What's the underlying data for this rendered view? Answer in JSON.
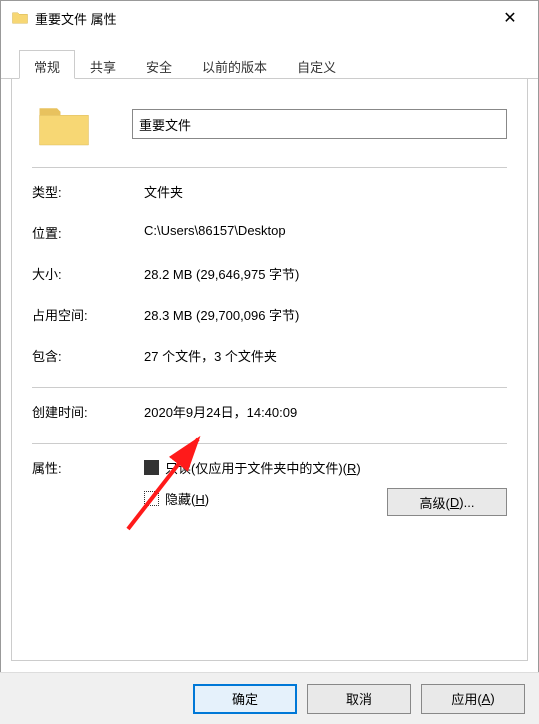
{
  "window": {
    "title": "重要文件 属性",
    "close_glyph": "✕"
  },
  "tabs": {
    "general": "常规",
    "share": "共享",
    "security": "安全",
    "previous": "以前的版本",
    "custom": "自定义"
  },
  "name_value": "重要文件",
  "labels": {
    "type": "类型:",
    "location": "位置:",
    "size": "大小:",
    "disk": "占用空间:",
    "contains": "包含:",
    "created": "创建时间:",
    "attrs": "属性:"
  },
  "values": {
    "type": "文件夹",
    "location": "C:\\Users\\86157\\Desktop",
    "size": "28.2 MB (29,646,975 字节)",
    "disk": "28.3 MB (29,700,096 字节)",
    "contains": "27 个文件，3 个文件夹",
    "created": "2020年9月24日，14:40:09"
  },
  "attrs": {
    "readonly_label_pre": "只读(仅应用于文件夹中的文件)(",
    "readonly_key": "R",
    "readonly_label_post": ")",
    "hidden_label_pre": "隐藏(",
    "hidden_key": "H",
    "hidden_label_post": ")",
    "advanced_pre": "高级(",
    "advanced_key": "D",
    "advanced_post": ")..."
  },
  "buttons": {
    "ok": "确定",
    "cancel": "取消",
    "apply_pre": "应用(",
    "apply_key": "A",
    "apply_post": ")"
  }
}
